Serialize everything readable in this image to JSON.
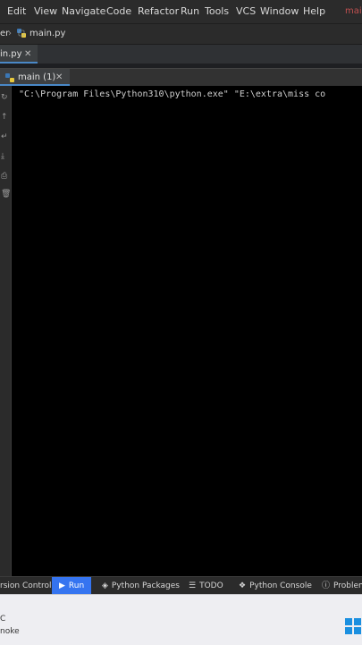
{
  "menubar": {
    "items": [
      "Edit",
      "View",
      "Navigate",
      "Code",
      "Refactor",
      "Run",
      "Tools",
      "VCS",
      "Window",
      "Help"
    ],
    "window_title": "mai"
  },
  "navbar": {
    "crumb_left": "er",
    "crumb_file": "main.py"
  },
  "editor": {
    "tab_label": "in.py"
  },
  "run": {
    "tab_label": "main (1)",
    "command_line": "\"C:\\Program Files\\Python310\\python.exe\" \"E:\\extra\\miss co"
  },
  "bottombar": {
    "tabs": [
      "rsion Control",
      "Run",
      "Python Packages",
      "TODO",
      "Python Console",
      "Problem"
    ]
  },
  "taskbar": {
    "line1": "C",
    "line2": "noke"
  },
  "colors": {
    "accent": "#4a88c7",
    "run_tab_active": "#3574f0",
    "title_red": "#c05050"
  }
}
